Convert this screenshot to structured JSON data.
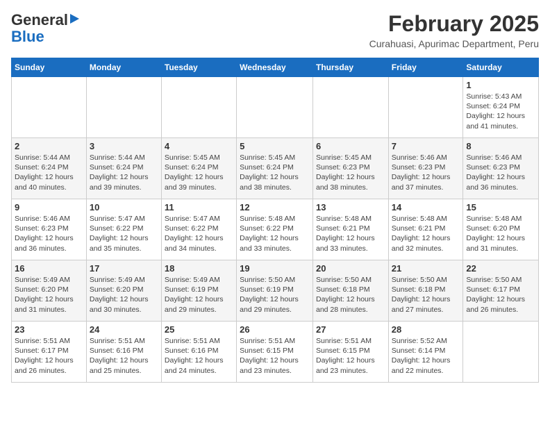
{
  "header": {
    "logo_general": "General",
    "logo_blue": "Blue",
    "month_year": "February 2025",
    "location": "Curahuasi, Apurimac Department, Peru"
  },
  "days_of_week": [
    "Sunday",
    "Monday",
    "Tuesday",
    "Wednesday",
    "Thursday",
    "Friday",
    "Saturday"
  ],
  "weeks": [
    [
      {
        "day": "",
        "info": ""
      },
      {
        "day": "",
        "info": ""
      },
      {
        "day": "",
        "info": ""
      },
      {
        "day": "",
        "info": ""
      },
      {
        "day": "",
        "info": ""
      },
      {
        "day": "",
        "info": ""
      },
      {
        "day": "1",
        "info": "Sunrise: 5:43 AM\nSunset: 6:24 PM\nDaylight: 12 hours\nand 41 minutes."
      }
    ],
    [
      {
        "day": "2",
        "info": "Sunrise: 5:44 AM\nSunset: 6:24 PM\nDaylight: 12 hours\nand 40 minutes."
      },
      {
        "day": "3",
        "info": "Sunrise: 5:44 AM\nSunset: 6:24 PM\nDaylight: 12 hours\nand 39 minutes."
      },
      {
        "day": "4",
        "info": "Sunrise: 5:45 AM\nSunset: 6:24 PM\nDaylight: 12 hours\nand 39 minutes."
      },
      {
        "day": "5",
        "info": "Sunrise: 5:45 AM\nSunset: 6:24 PM\nDaylight: 12 hours\nand 38 minutes."
      },
      {
        "day": "6",
        "info": "Sunrise: 5:45 AM\nSunset: 6:23 PM\nDaylight: 12 hours\nand 38 minutes."
      },
      {
        "day": "7",
        "info": "Sunrise: 5:46 AM\nSunset: 6:23 PM\nDaylight: 12 hours\nand 37 minutes."
      },
      {
        "day": "8",
        "info": "Sunrise: 5:46 AM\nSunset: 6:23 PM\nDaylight: 12 hours\nand 36 minutes."
      }
    ],
    [
      {
        "day": "9",
        "info": "Sunrise: 5:46 AM\nSunset: 6:23 PM\nDaylight: 12 hours\nand 36 minutes."
      },
      {
        "day": "10",
        "info": "Sunrise: 5:47 AM\nSunset: 6:22 PM\nDaylight: 12 hours\nand 35 minutes."
      },
      {
        "day": "11",
        "info": "Sunrise: 5:47 AM\nSunset: 6:22 PM\nDaylight: 12 hours\nand 34 minutes."
      },
      {
        "day": "12",
        "info": "Sunrise: 5:48 AM\nSunset: 6:22 PM\nDaylight: 12 hours\nand 33 minutes."
      },
      {
        "day": "13",
        "info": "Sunrise: 5:48 AM\nSunset: 6:21 PM\nDaylight: 12 hours\nand 33 minutes."
      },
      {
        "day": "14",
        "info": "Sunrise: 5:48 AM\nSunset: 6:21 PM\nDaylight: 12 hours\nand 32 minutes."
      },
      {
        "day": "15",
        "info": "Sunrise: 5:48 AM\nSunset: 6:20 PM\nDaylight: 12 hours\nand 31 minutes."
      }
    ],
    [
      {
        "day": "16",
        "info": "Sunrise: 5:49 AM\nSunset: 6:20 PM\nDaylight: 12 hours\nand 31 minutes."
      },
      {
        "day": "17",
        "info": "Sunrise: 5:49 AM\nSunset: 6:20 PM\nDaylight: 12 hours\nand 30 minutes."
      },
      {
        "day": "18",
        "info": "Sunrise: 5:49 AM\nSunset: 6:19 PM\nDaylight: 12 hours\nand 29 minutes."
      },
      {
        "day": "19",
        "info": "Sunrise: 5:50 AM\nSunset: 6:19 PM\nDaylight: 12 hours\nand 29 minutes."
      },
      {
        "day": "20",
        "info": "Sunrise: 5:50 AM\nSunset: 6:18 PM\nDaylight: 12 hours\nand 28 minutes."
      },
      {
        "day": "21",
        "info": "Sunrise: 5:50 AM\nSunset: 6:18 PM\nDaylight: 12 hours\nand 27 minutes."
      },
      {
        "day": "22",
        "info": "Sunrise: 5:50 AM\nSunset: 6:17 PM\nDaylight: 12 hours\nand 26 minutes."
      }
    ],
    [
      {
        "day": "23",
        "info": "Sunrise: 5:51 AM\nSunset: 6:17 PM\nDaylight: 12 hours\nand 26 minutes."
      },
      {
        "day": "24",
        "info": "Sunrise: 5:51 AM\nSunset: 6:16 PM\nDaylight: 12 hours\nand 25 minutes."
      },
      {
        "day": "25",
        "info": "Sunrise: 5:51 AM\nSunset: 6:16 PM\nDaylight: 12 hours\nand 24 minutes."
      },
      {
        "day": "26",
        "info": "Sunrise: 5:51 AM\nSunset: 6:15 PM\nDaylight: 12 hours\nand 23 minutes."
      },
      {
        "day": "27",
        "info": "Sunrise: 5:51 AM\nSunset: 6:15 PM\nDaylight: 12 hours\nand 23 minutes."
      },
      {
        "day": "28",
        "info": "Sunrise: 5:52 AM\nSunset: 6:14 PM\nDaylight: 12 hours\nand 22 minutes."
      },
      {
        "day": "",
        "info": ""
      }
    ]
  ]
}
